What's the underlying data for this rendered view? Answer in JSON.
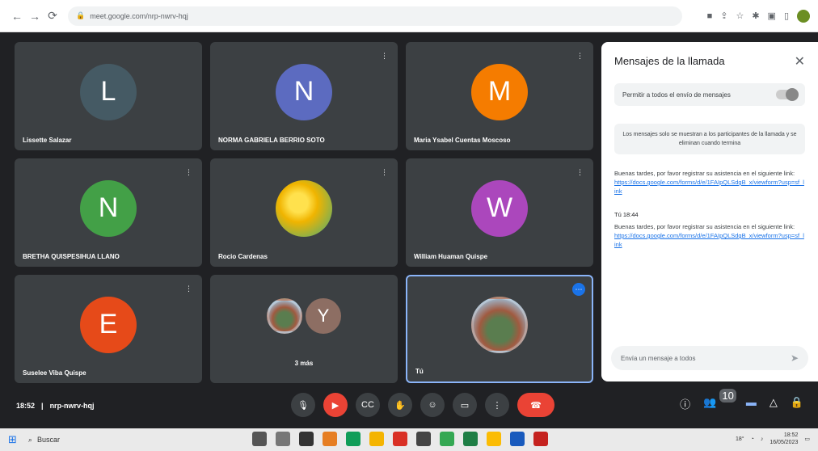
{
  "browser": {
    "url": "meet.google.com/nrp-nwrv-hqj"
  },
  "participants": [
    {
      "initial": "L",
      "name": "Lissette Salazar",
      "color": "#455a64",
      "muted": false
    },
    {
      "initial": "N",
      "name": "NORMA GABRIELA BERRIO SOTO",
      "color": "#5c6bc0",
      "muted": true
    },
    {
      "initial": "M",
      "name": "Maria Ysabel Cuentas Moscoso",
      "color": "#f57c00",
      "muted": true
    },
    {
      "initial": "N",
      "name": "BRETHA QUISPESIHUA LLANO",
      "color": "#43a047",
      "muted": true
    },
    {
      "initial": "",
      "name": "Rocio Cardenas",
      "color": "",
      "muted": true
    },
    {
      "initial": "W",
      "name": "William Huaman Quispe",
      "color": "#ab47bc",
      "muted": true
    },
    {
      "initial": "E",
      "name": "Suselee Viba Quispe",
      "color": "#e64a19",
      "muted": true
    },
    {
      "initial": "Y",
      "name": "3 más",
      "color": "#8d6e63",
      "muted": false
    },
    {
      "initial": "",
      "name": "Tú",
      "color": "",
      "muted": false
    }
  ],
  "chat": {
    "title": "Mensajes de la llamada",
    "toggle_label": "Permitir a todos el envío de mensajes",
    "info": "Los mensajes solo se muestran a los participantes de la llamada y se eliminan cuando termina",
    "messages": [
      {
        "sender": "",
        "text": "Buenas tardes, por favor registrar su asistencia en el siguiente link:",
        "link": "https://docs.google.com/forms/d/e/1FAIpQLSdgB_x/viewform?usp=sf_link"
      },
      {
        "sender": "Tú  18:44",
        "text": "Buenas tardes, por favor registrar su asistencia en el siguiente link:",
        "link": "https://docs.google.com/forms/d/e/1FAIpQLSdgB_x/viewform?usp=sf_link"
      }
    ],
    "input_placeholder": "Envía un mensaje a todos"
  },
  "meeting": {
    "time": "18:52",
    "code": "nrp-nwrv-hqj"
  },
  "participants_badge": "10",
  "taskbar": {
    "search_placeholder": "Buscar",
    "weather": "18°",
    "time": "18:52",
    "date": "16/05/2023"
  }
}
